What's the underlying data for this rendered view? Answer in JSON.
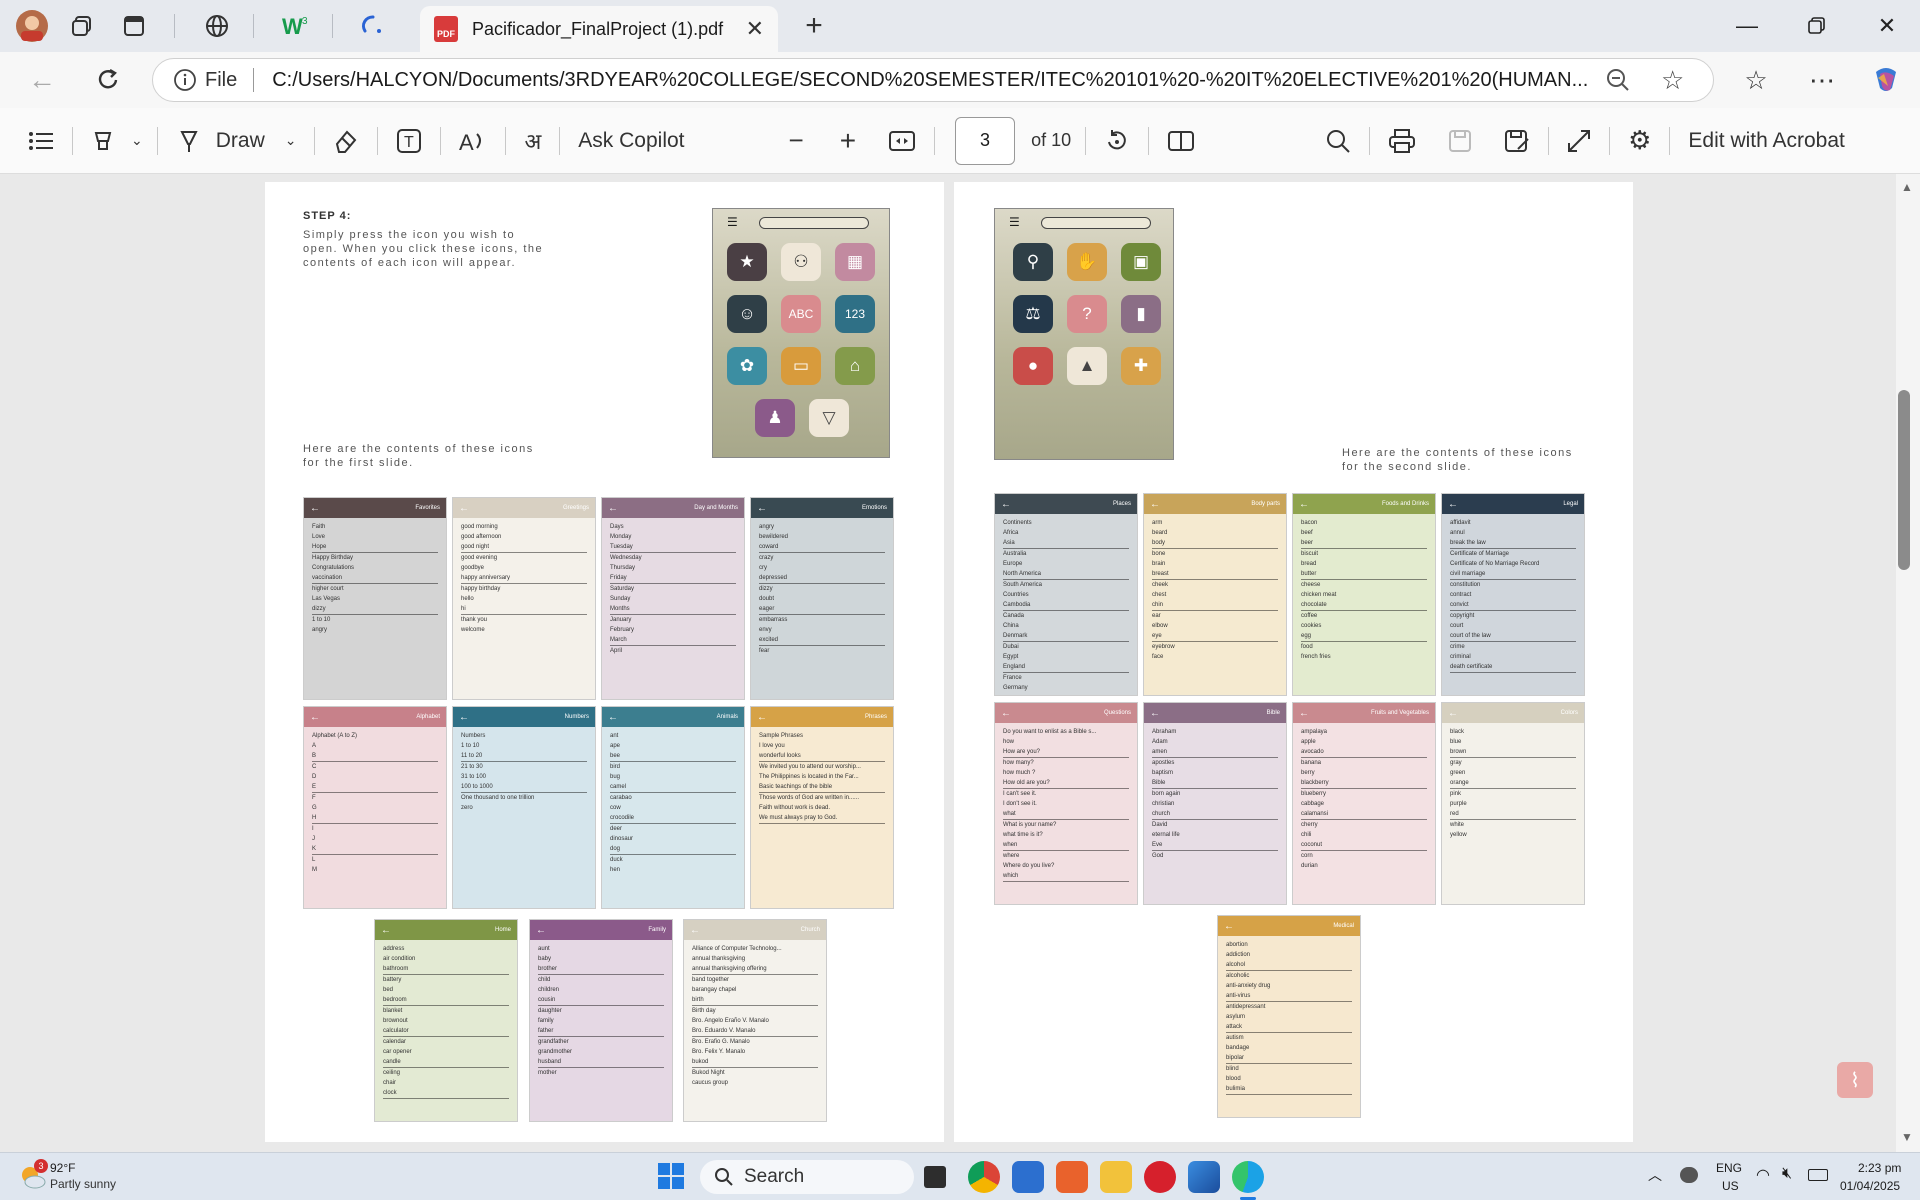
{
  "browser": {
    "tab_title": "Pacificador_FinalProject (1).pdf",
    "pdf_badge": "PDF",
    "file_label": "File",
    "url": "C:/Users/HALCYON/Documents/3RDYEAR%20COLLEGE/SECOND%20SEMESTER/ITEC%20101%20-%20IT%20ELECTIVE%201%20(HUMAN..."
  },
  "toolbar": {
    "draw_label": "Draw",
    "ask_copilot": "Ask Copilot",
    "page_current": "3",
    "page_total": "of 10",
    "edit_acrobat": "Edit with Acrobat"
  },
  "page_left": {
    "step_title": "STEP 4:",
    "step_text": "Simply press the icon you wish to open. When you click these icons, the contents of each icon will appear.",
    "caption": "Here are the contents of these icons for the first slide.",
    "cards": [
      {
        "title": "Favorites",
        "color": "#5a4a4a",
        "bg": "#d4d4d4",
        "words": [
          "Faith",
          "Love",
          "Hope",
          "Happy Birthday",
          "Congratulations",
          "vaccination",
          "higher court",
          "Las Vegas",
          "dizzy",
          "1 to 10",
          "angry"
        ]
      },
      {
        "title": "Greetings",
        "color": "#d8d0c2",
        "bg": "#f4f1ea",
        "words": [
          "good morning",
          "good afternoon",
          "good night",
          "good evening",
          "goodbye",
          "happy anniversary",
          "happy birthday",
          "hello",
          "hi",
          "thank you",
          "welcome"
        ]
      },
      {
        "title": "Day and Months",
        "color": "#8c6e84",
        "bg": "#e6dbe3",
        "words": [
          "Days",
          "Monday",
          "Tuesday",
          "Wednesday",
          "Thursday",
          "Friday",
          "Saturday",
          "Sunday",
          "Months",
          "January",
          "February",
          "March",
          "April"
        ]
      },
      {
        "title": "Emotions",
        "color": "#394a52",
        "bg": "#cfd6d9",
        "words": [
          "angry",
          "bewildered",
          "coward",
          "crazy",
          "cry",
          "depressed",
          "dizzy",
          "doubt",
          "eager",
          "embarrass",
          "envy",
          "excited",
          "fear"
        ]
      },
      {
        "title": "Alphabet",
        "color": "#c7818a",
        "bg": "#f1dcdf",
        "words": [
          "Alphabet (A to Z)",
          "A",
          "B",
          "C",
          "D",
          "E",
          "F",
          "G",
          "H",
          "I",
          "J",
          "K",
          "L",
          "M"
        ]
      },
      {
        "title": "Numbers",
        "color": "#2f7086",
        "bg": "#d5e5ec",
        "words": [
          "Numbers",
          "1 to 10",
          "11 to 20",
          "21 to 30",
          "31 to 100",
          "100 to 1000",
          "One thousand to one trillion",
          "zero"
        ]
      },
      {
        "title": "Animals",
        "color": "#3c7e8f",
        "bg": "#d7e7ec",
        "words": [
          "ant",
          "ape",
          "bee",
          "bird",
          "bug",
          "camel",
          "carabao",
          "cow",
          "crocodile",
          "deer",
          "dinosaur",
          "dog",
          "duck",
          "hen"
        ]
      },
      {
        "title": "Phrases",
        "color": "#d6a247",
        "bg": "#f7ead2",
        "words": [
          "Sample Phrases",
          "I love you",
          "wonderful looks",
          "We invited you to attend our worship...",
          "The Philippines is located in the Far...",
          "Basic teachings of the bible",
          "Those words of God are written in......",
          "Faith without work is dead.",
          "We must always pray to God."
        ]
      },
      {
        "title": "Home",
        "color": "#7f9646",
        "bg": "#e3ead3",
        "words": [
          "address",
          "air condition",
          "bathroom",
          "battery",
          "bed",
          "bedroom",
          "blanket",
          "brownout",
          "calculator",
          "calendar",
          "car opener",
          "candle",
          "ceiling",
          "chair",
          "clock"
        ]
      },
      {
        "title": "Family",
        "color": "#8b5a8a",
        "bg": "#e5d8e4",
        "words": [
          "aunt",
          "baby",
          "brother",
          "child",
          "children",
          "cousin",
          "daughter",
          "family",
          "father",
          "grandfather",
          "grandmother",
          "husband",
          "mother"
        ]
      },
      {
        "title": "Church",
        "color": "#d6d0c2",
        "bg": "#f4f2ec",
        "words": [
          "Alliance of Computer Technolog...",
          "annual thanksgiving",
          "annual thanksgiving offering",
          "band together",
          "barangay chapel",
          "birth",
          "Birth day",
          "Bro. Angelo Eraño V. Manalo",
          "Bro. Eduardo V. Manalo",
          "Bro. Erafio G. Manalo",
          "Bro. Felix Y. Manalo",
          "bukod",
          "Bukod Night",
          "caucus group"
        ]
      }
    ]
  },
  "page_right": {
    "caption": "Here are the contents of these icons for the second slide.",
    "cards": [
      {
        "title": "Places",
        "color": "#3e4a52",
        "bg": "#d3d8db",
        "words": [
          "Continents",
          "Africa",
          "Asia",
          "Australia",
          "Europe",
          "North America",
          "South America",
          "Countries",
          "Cambodia",
          "Canada",
          "China",
          "Denmark",
          "Dubai",
          "Egypt",
          "England",
          "France",
          "Germany"
        ]
      },
      {
        "title": "Body parts",
        "color": "#c8a45a",
        "bg": "#f5ead0",
        "words": [
          "arm",
          "beard",
          "body",
          "bone",
          "brain",
          "breast",
          "cheek",
          "chest",
          "chin",
          "ear",
          "elbow",
          "eye",
          "eyebrow",
          "face"
        ]
      },
      {
        "title": "Foods and Drinks",
        "color": "#8fa34e",
        "bg": "#e3ebcf",
        "words": [
          "bacon",
          "beef",
          "beer",
          "biscuit",
          "bread",
          "butter",
          "cheese",
          "chicken meat",
          "chocolate",
          "coffee",
          "cookies",
          "egg",
          "food",
          "french fries"
        ]
      },
      {
        "title": "Legal",
        "color": "#2b3d4f",
        "bg": "#d0d6dc",
        "words": [
          "affidavit",
          "annul",
          "break the law",
          "Certificate of Marriage",
          "Certificate of No Marriage Record",
          "civil marriage",
          "constitution",
          "contract",
          "convict",
          "copyright",
          "court",
          "court of the law",
          "crime",
          "criminal",
          "death certificate"
        ]
      },
      {
        "title": "Questions",
        "color": "#c98a8f",
        "bg": "#f2dfe1",
        "words": [
          "Do you want to enlist as a Bible s...",
          "how",
          "How are you?",
          "how many?",
          "how much ?",
          "How old are you?",
          "I can't see it.",
          "I don't see it.",
          "what",
          "What is your name?",
          "what time is it?",
          "when",
          "where",
          "Where do you live?",
          "which"
        ]
      },
      {
        "title": "Bible",
        "color": "#8b6e86",
        "bg": "#e7dde5",
        "words": [
          "Abraham",
          "Adam",
          "amen",
          "apostles",
          "baptism",
          "Bible",
          "born again",
          "christian",
          "church",
          "David",
          "eternal life",
          "Eve",
          "God"
        ]
      },
      {
        "title": "Fruits and Vegetables",
        "color": "#c98a8f",
        "bg": "#f3e1e3",
        "words": [
          "ampalaya",
          "apple",
          "avocado",
          "banana",
          "berry",
          "blackberry",
          "blueberry",
          "cabbage",
          "calamansi",
          "cherry",
          "chili",
          "coconut",
          "corn",
          "durian"
        ]
      },
      {
        "title": "Colors",
        "color": "#d6d0bf",
        "bg": "#f3f1ea",
        "words": [
          "black",
          "blue",
          "brown",
          "gray",
          "green",
          "orange",
          "pink",
          "purple",
          "red",
          "white",
          "yellow"
        ]
      },
      {
        "title": "Medical",
        "color": "#d6a247",
        "bg": "#f6e8cf",
        "words": [
          "abortion",
          "addiction",
          "alcohol",
          "alcoholic",
          "anti-anxiety drug",
          "anti-virus",
          "antidepressant",
          "asylum",
          "attack",
          "autism",
          "bandage",
          "bipolar",
          "blind",
          "blood",
          "bulimia"
        ]
      }
    ]
  },
  "taskbar": {
    "weather_temp": "92°F",
    "weather_text": "Partly sunny",
    "weather_badge": "3",
    "search_label": "Search",
    "lang_top": "ENG",
    "lang_bottom": "US",
    "time": "2:23 pm",
    "date": "01/04/2025"
  }
}
